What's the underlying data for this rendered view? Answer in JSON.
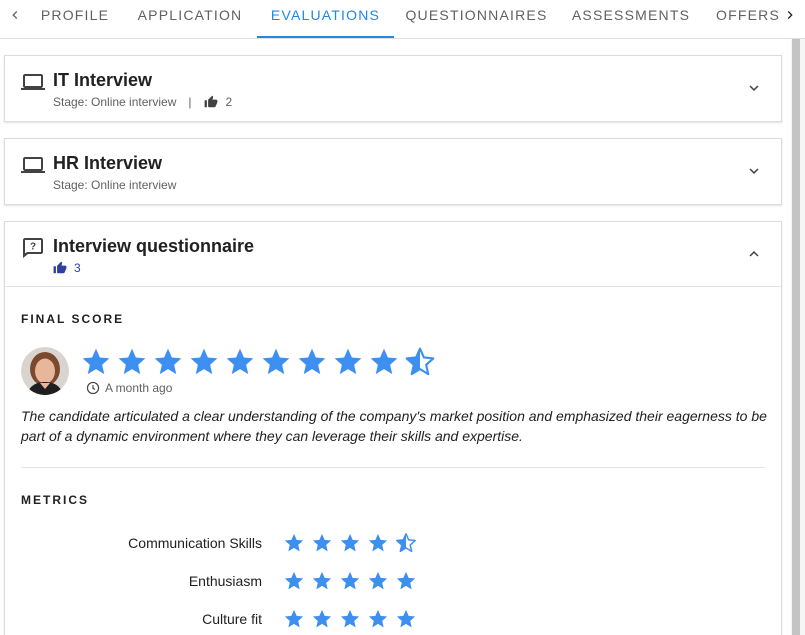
{
  "tabs": [
    "PROFILE",
    "APPLICATION",
    "EVALUATIONS",
    "QUESTIONNAIRES",
    "ASSESSMENTS",
    "OFFERS"
  ],
  "active_tab": "EVALUATIONS",
  "accent_color": "#1e88e5",
  "star_color": "#3d8ff0",
  "evaluations": [
    {
      "title": "IT Interview",
      "stage": "Stage: Online interview",
      "likes": "2",
      "icon": "laptop-icon",
      "state": "collapsed"
    },
    {
      "title": "HR Interview",
      "stage": "Stage: Online interview",
      "icon": "laptop-icon",
      "state": "collapsed"
    },
    {
      "title": "Interview questionnaire",
      "likes": "3",
      "icon": "question-bubble-icon",
      "state": "expanded"
    }
  ],
  "final_score": {
    "heading": "FINAL SCORE",
    "rating": 9.5,
    "max": 10,
    "time": "A month ago",
    "comment": "The candidate articulated a clear understanding of the company's market position and emphasized their eagerness to be part of a dynamic environment where they can leverage their skills and expertise."
  },
  "metrics": {
    "heading": "METRICS",
    "items": [
      {
        "label": "Communication Skills",
        "rating": 4.5,
        "max": 5
      },
      {
        "label": "Enthusiasm",
        "rating": 5,
        "max": 5
      },
      {
        "label": "Culture fit",
        "rating": 5,
        "max": 5
      }
    ]
  }
}
